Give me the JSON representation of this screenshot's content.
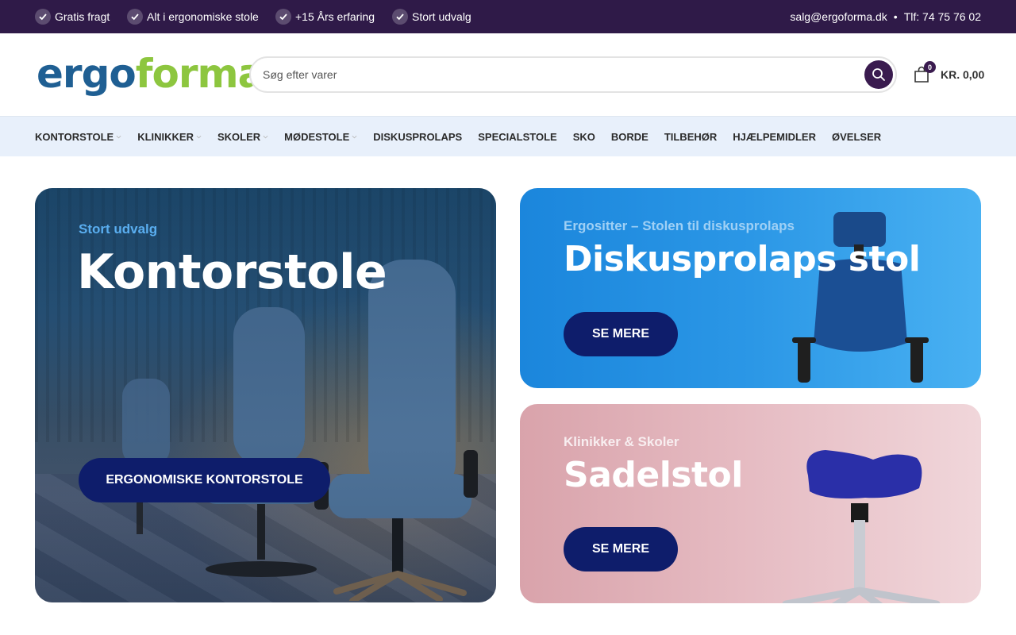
{
  "topbar": {
    "usps": [
      "Gratis fragt",
      "Alt i ergonomiske stole",
      "+15 Års erfaring",
      "Stort udvalg"
    ],
    "email": "salg@ergoforma.dk",
    "separator": "•",
    "phone": "Tlf: 74 75 76 02"
  },
  "header": {
    "logo_part1": "ergo",
    "logo_part2": "forma",
    "search_placeholder": "Søg efter varer",
    "cart_count": "0",
    "cart_amount": "KR. 0,00"
  },
  "nav": {
    "items": [
      {
        "label": "KONTORSTOLE",
        "has_dropdown": true
      },
      {
        "label": "KLINIKKER",
        "has_dropdown": true
      },
      {
        "label": "SKOLER",
        "has_dropdown": true
      },
      {
        "label": "MØDESTOLE",
        "has_dropdown": true
      },
      {
        "label": "DISKUSPROLAPS",
        "has_dropdown": false
      },
      {
        "label": "SPECIALSTOLE",
        "has_dropdown": false
      },
      {
        "label": "SKO",
        "has_dropdown": false
      },
      {
        "label": "BORDE",
        "has_dropdown": false
      },
      {
        "label": "TILBEHØR",
        "has_dropdown": false
      },
      {
        "label": "HJÆLPEMIDLER",
        "has_dropdown": false
      },
      {
        "label": "ØVELSER",
        "has_dropdown": false
      }
    ]
  },
  "banners": {
    "main": {
      "kicker": "Stort udvalg",
      "title": "Kontorstole",
      "button": "ERGONOMISKE KONTORSTOLE"
    },
    "top": {
      "kicker": "Ergositter – Stolen til diskusprolaps",
      "title": "Diskusprolaps stol",
      "button": "SE MERE"
    },
    "bottom": {
      "kicker": "Klinikker & Skoler",
      "title": "Sadelstol",
      "button": "SE MERE"
    }
  },
  "colors": {
    "topbar_bg": "#2f1a48",
    "nav_bg": "#e8f0fb",
    "logo_blue": "#1f5f93",
    "logo_green": "#8dc63f",
    "cta_bg": "#0e1d6b",
    "accent_purple": "#3a1b4f"
  },
  "icons": {
    "usp": "check-icon",
    "search": "search-icon",
    "cart": "shopping-bag-icon",
    "dropdown": "chevron-down-icon"
  }
}
